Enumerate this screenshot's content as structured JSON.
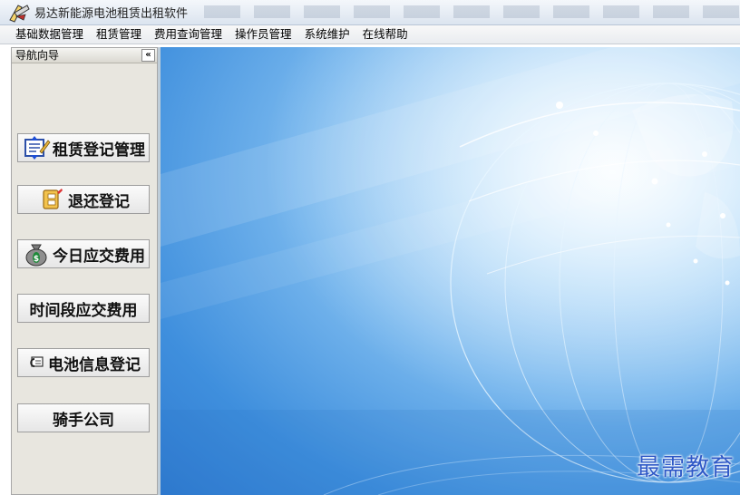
{
  "window": {
    "title": "易达新能源电池租赁出租软件"
  },
  "menubar": {
    "items": [
      "基础数据管理",
      "租赁管理",
      "费用查询管理",
      "操作员管理",
      "系统维护",
      "在线帮助"
    ]
  },
  "nav": {
    "header": "导航向导",
    "collapse_label": "«",
    "buttons": [
      {
        "label": "租赁登记管理",
        "icon": "register-icon"
      },
      {
        "label": "退还登记",
        "icon": "folder-return-icon"
      },
      {
        "label": "今日应交费用",
        "icon": "money-bag-icon"
      },
      {
        "label": "时间段应交费用",
        "icon": ""
      },
      {
        "label": "电池信息登记",
        "icon": "battery-info-icon"
      },
      {
        "label": "骑手公司",
        "icon": ""
      }
    ]
  },
  "main": {
    "watermark": "最需教育"
  }
}
